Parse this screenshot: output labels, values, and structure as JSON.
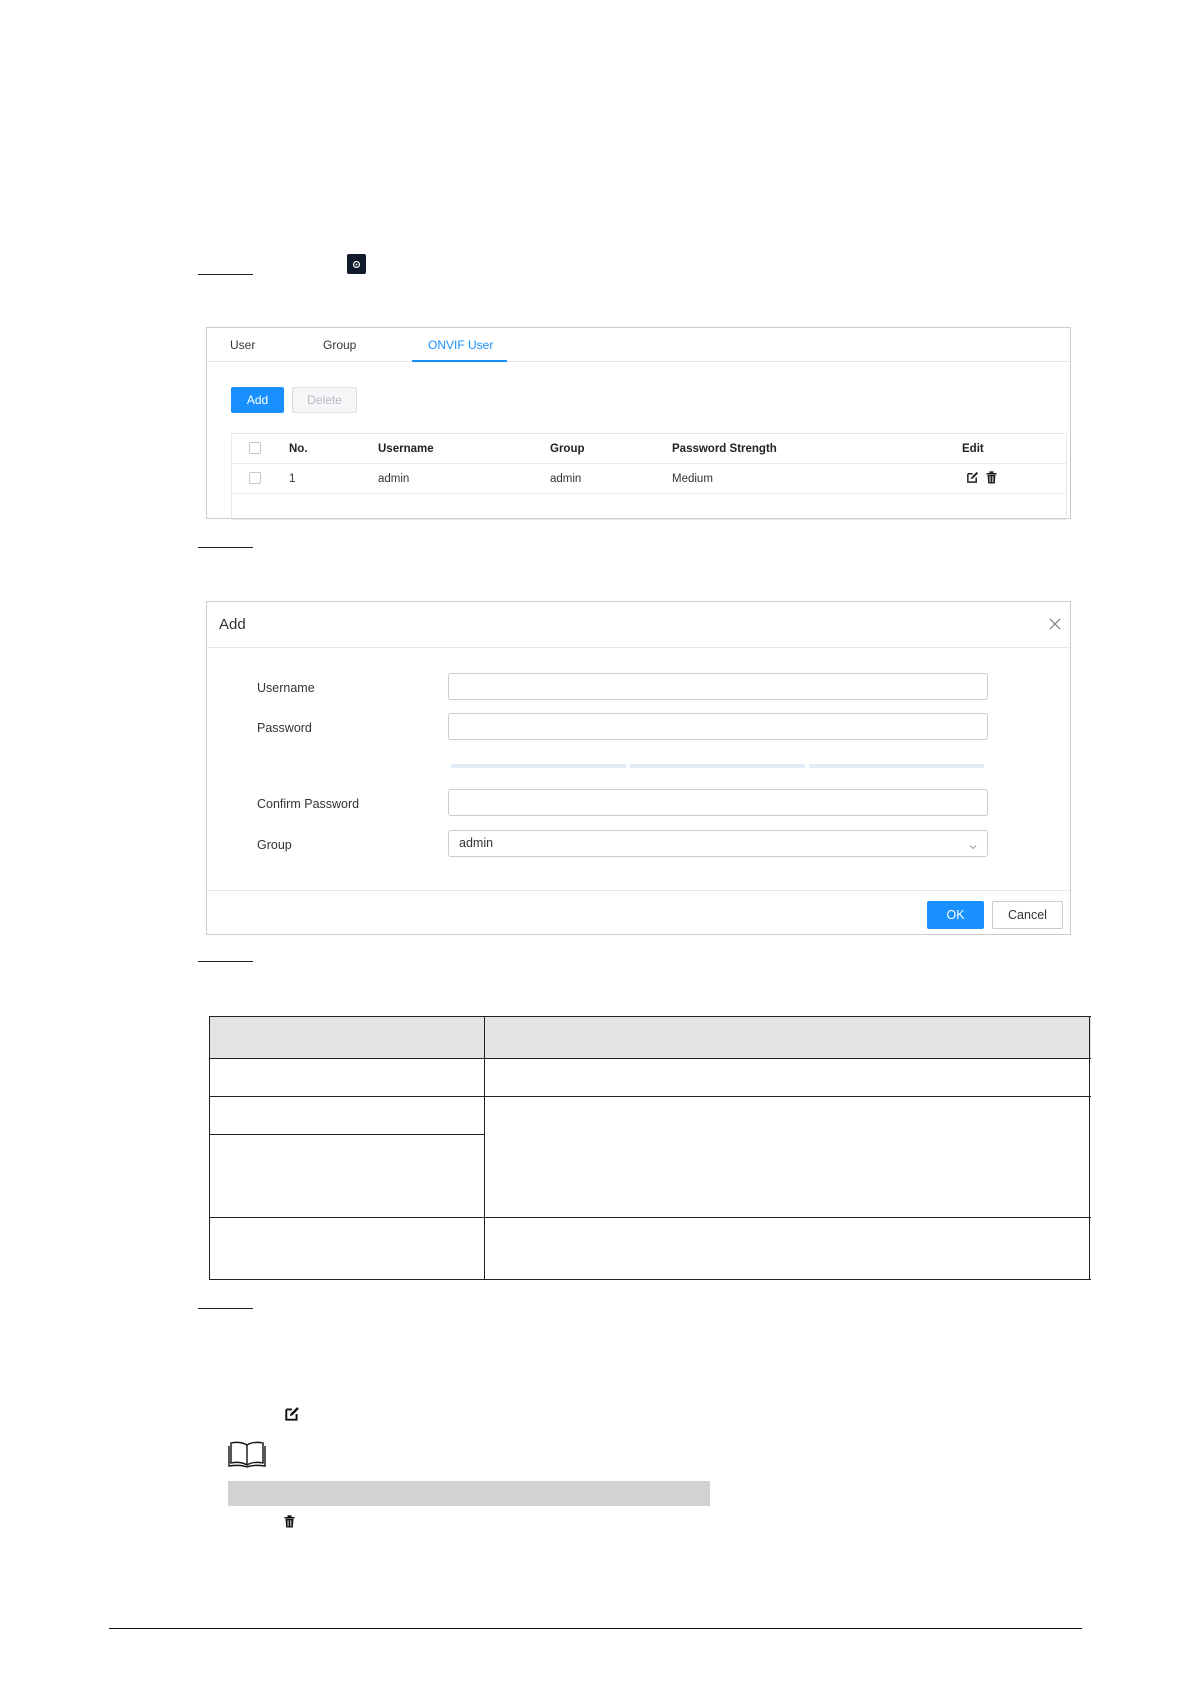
{
  "settings_icon": "gear-icon",
  "user_list": {
    "tabs": [
      {
        "label": "User",
        "active": false
      },
      {
        "label": "Group",
        "active": false
      },
      {
        "label": "ONVIF User",
        "active": true
      }
    ],
    "add_label": "Add",
    "delete_label": "Delete",
    "columns": [
      "No.",
      "Username",
      "Group",
      "Password Strength",
      "Edit"
    ],
    "rows": [
      {
        "no": "1",
        "username": "admin",
        "group": "admin",
        "strength": "Medium"
      }
    ],
    "edit_icon": "edit-icon",
    "delete_icon": "trash-icon",
    "accent_color": "#1890ff"
  },
  "add_dialog": {
    "title": "Add",
    "fields": {
      "username_label": "Username",
      "password_label": "Password",
      "confirm_label": "Confirm Password",
      "group_label": "Group",
      "group_value": "admin"
    },
    "ok_label": "OK",
    "cancel_label": "Cancel"
  },
  "notes": {
    "edit_icon": "edit-icon",
    "note_icon": "book-icon",
    "delete_icon": "trash-icon"
  }
}
